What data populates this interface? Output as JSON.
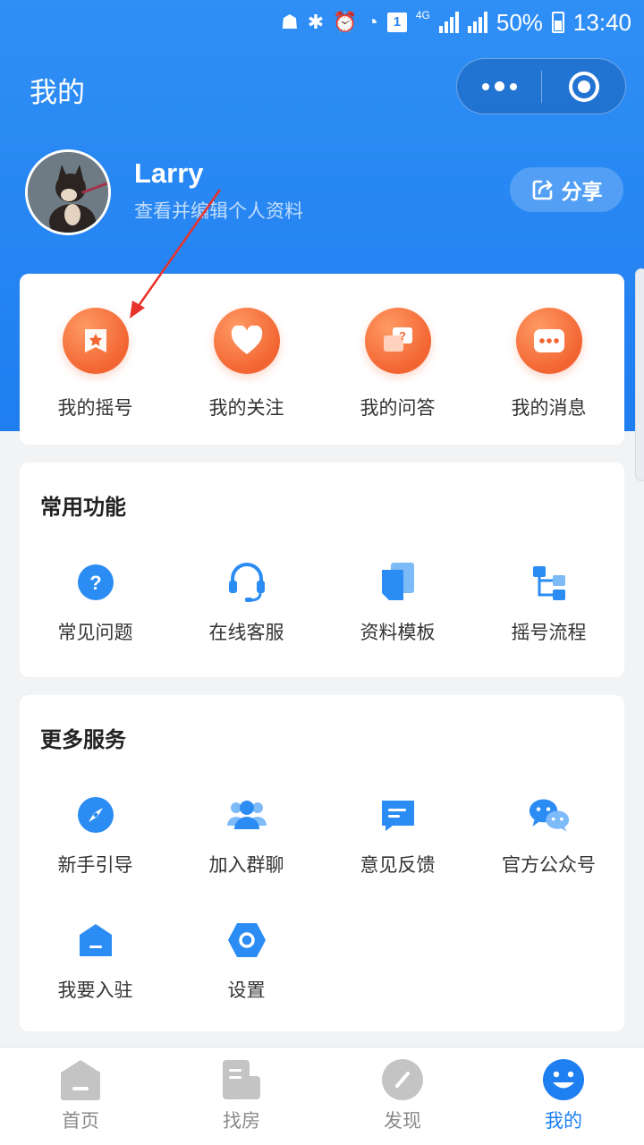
{
  "status_bar": {
    "network": "4G",
    "sim": "1",
    "battery": "50%",
    "time": "13:40"
  },
  "header": {
    "title": "我的"
  },
  "profile": {
    "name": "Larry",
    "subtitle": "查看并编辑个人资料",
    "share_label": "分享"
  },
  "quick_actions": [
    {
      "label": "我的摇号",
      "icon": "bookmark-star-icon"
    },
    {
      "label": "我的关注",
      "icon": "heart-icon"
    },
    {
      "label": "我的问答",
      "icon": "question-chat-icon"
    },
    {
      "label": "我的消息",
      "icon": "message-icon"
    }
  ],
  "common": {
    "title": "常用功能",
    "items": [
      {
        "label": "常见问题",
        "icon": "help-icon"
      },
      {
        "label": "在线客服",
        "icon": "headset-icon"
      },
      {
        "label": "资料模板",
        "icon": "document-template-icon"
      },
      {
        "label": "摇号流程",
        "icon": "flow-icon"
      }
    ]
  },
  "more": {
    "title": "更多服务",
    "items": [
      {
        "label": "新手引导",
        "icon": "compass-icon"
      },
      {
        "label": "加入群聊",
        "icon": "group-icon"
      },
      {
        "label": "意见反馈",
        "icon": "feedback-icon"
      },
      {
        "label": "官方公众号",
        "icon": "wechat-icon"
      },
      {
        "label": "我要入驻",
        "icon": "house-icon"
      },
      {
        "label": "设置",
        "icon": "settings-icon"
      }
    ]
  },
  "tabbar": [
    {
      "label": "首页",
      "icon": "home-icon",
      "active": false
    },
    {
      "label": "找房",
      "icon": "find-house-icon",
      "active": false
    },
    {
      "label": "发现",
      "icon": "discover-icon",
      "active": false
    },
    {
      "label": "我的",
      "icon": "profile-smile-icon",
      "active": true
    }
  ],
  "colors": {
    "primary": "#1e7ff1",
    "accent_orange": "#f26532",
    "inactive": "#c4c4c4"
  }
}
